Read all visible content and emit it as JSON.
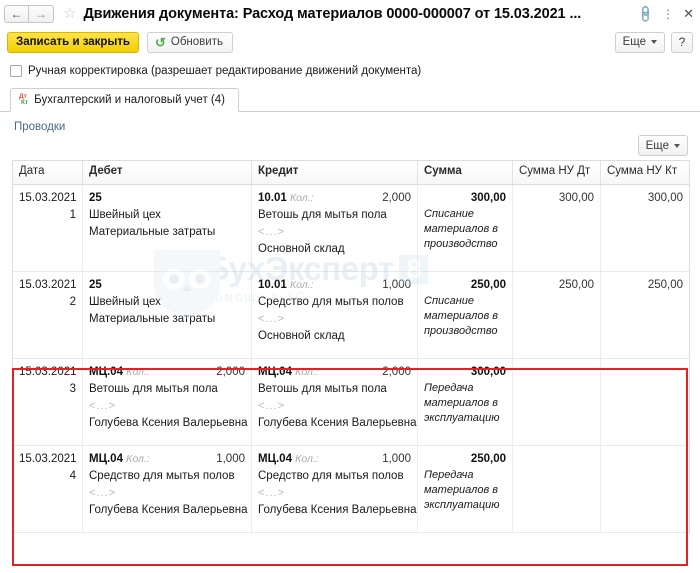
{
  "window": {
    "title": "Движения документа: Расход материалов 0000-000007 от 15.03.2021 ...",
    "back_icon": "←",
    "forward_icon": "→",
    "favorite_icon": "☆",
    "link_icon": "🔗",
    "menu_icon": "⋮",
    "close_icon": "✕"
  },
  "toolbar": {
    "save_and_close": "Записать и закрыть",
    "refresh": "Обновить",
    "refresh_icon": "↻",
    "more": "Еще",
    "help": "?"
  },
  "options": {
    "manual_correction": "Ручная корректировка (разрешает редактирование движений документа)",
    "manual_correction_checked": false
  },
  "tabs": [
    {
      "label": "Бухгалтерский и налоговый учет (4)",
      "icon_dt": "Дт",
      "icon_kt": "Кт",
      "active": true
    }
  ],
  "section": {
    "title": "Проводки",
    "more": "Еще"
  },
  "table": {
    "columns": [
      "Дата",
      "Дебет",
      "Кредит",
      "Сумма",
      "Сумма НУ Дт",
      "Сумма НУ Кт"
    ],
    "rows": [
      {
        "date": "15.03.2021",
        "index": "1",
        "debit_account": "25",
        "debit_qty_label": "",
        "debit_qty": "",
        "debit_lines": [
          "Швейный цех",
          "Материальные затраты",
          ""
        ],
        "credit_account": "10.01",
        "credit_qty_label": "Кол.:",
        "credit_qty": "2,000",
        "credit_lines": [
          "Ветошь для мытья пола",
          "<...>",
          "Основной склад"
        ],
        "amount": "300,00",
        "note": "Списание материалов в производство",
        "nu_dt": "300,00",
        "nu_kt": "300,00",
        "highlighted": false
      },
      {
        "date": "15.03.2021",
        "index": "2",
        "debit_account": "25",
        "debit_qty_label": "",
        "debit_qty": "",
        "debit_lines": [
          "Швейный цех",
          "Материальные затраты",
          ""
        ],
        "credit_account": "10.01",
        "credit_qty_label": "Кол.:",
        "credit_qty": "1,000",
        "credit_lines": [
          "Средство для мытья полов",
          "<...>",
          "Основной склад"
        ],
        "amount": "250,00",
        "note": "Списание материалов в производство",
        "nu_dt": "250,00",
        "nu_kt": "250,00",
        "highlighted": false
      },
      {
        "date": "15.03.2021",
        "index": "3",
        "debit_account": "МЦ.04",
        "debit_qty_label": "Кол.:",
        "debit_qty": "2,000",
        "debit_lines": [
          "Ветошь для мытья пола",
          "<...>",
          "Голубева Ксения Валерьевна"
        ],
        "credit_account": "МЦ.04",
        "credit_qty_label": "Кол.:",
        "credit_qty": "2,000",
        "credit_lines": [
          "Ветошь для мытья пола",
          "<...>",
          "Голубева Ксения Валерьевна"
        ],
        "amount": "300,00",
        "note": "Передача материалов в эксплуатацию",
        "nu_dt": "",
        "nu_kt": "",
        "highlighted": true
      },
      {
        "date": "15.03.2021",
        "index": "4",
        "debit_account": "МЦ.04",
        "debit_qty_label": "Кол.:",
        "debit_qty": "1,000",
        "debit_lines": [
          "Средство для мытья полов",
          "<...>",
          "Голубева Ксения Валерьевна"
        ],
        "credit_account": "МЦ.04",
        "credit_qty_label": "Кол.:",
        "credit_qty": "1,000",
        "credit_lines": [
          "Средство для мытья полов",
          "<...>",
          "Голубева Ксения Валерьевна"
        ],
        "amount": "250,00",
        "note": "Передача материалов в эксплуатацию",
        "nu_dt": "",
        "nu_kt": "",
        "highlighted": true
      }
    ]
  },
  "watermark": {
    "text": "БухЭксперт",
    "badge": "8",
    "subtitle": "помощь в 1С"
  },
  "colors": {
    "accent_yellow": "#f2cf00",
    "highlight_red": "#e02424",
    "green": "#4fae4f",
    "section_blue": "#4a6b8a"
  }
}
